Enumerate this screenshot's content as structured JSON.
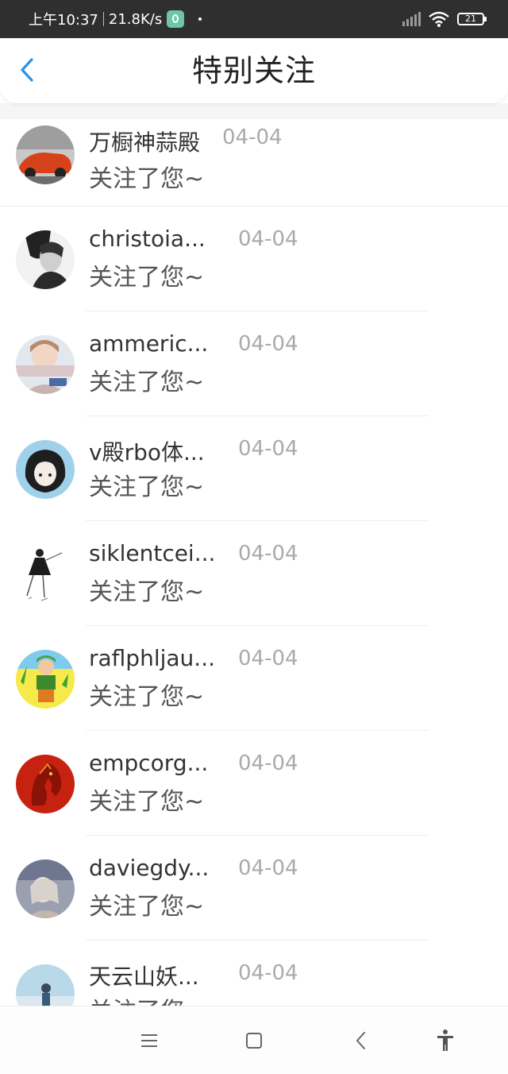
{
  "status_bar": {
    "time": "上午10:37",
    "speed": "21.8K/s",
    "battery": "21"
  },
  "header": {
    "title": "特别关注"
  },
  "items": [
    {
      "name": "万橱神蒜殿",
      "date": "04-04",
      "message": "关注了您~"
    },
    {
      "name": "christoia...",
      "date": "04-04",
      "message": "关注了您~"
    },
    {
      "name": "ammeric...",
      "date": "04-04",
      "message": "关注了您~"
    },
    {
      "name": "v殿rbo体...",
      "date": "04-04",
      "message": "关注了您~"
    },
    {
      "name": "siklentcei...",
      "date": "04-04",
      "message": "关注了您~"
    },
    {
      "name": "raflphljau...",
      "date": "04-04",
      "message": "关注了您~"
    },
    {
      "name": "empcorg...",
      "date": "04-04",
      "message": "关注了您~"
    },
    {
      "name": "daviegdy...",
      "date": "04-04",
      "message": "关注了您~"
    },
    {
      "name": "天云山妖...",
      "date": "04-04",
      "message": "关注了您~"
    }
  ],
  "nav": {
    "icons": [
      "menu-icon",
      "home-icon",
      "back-icon",
      "accessibility-icon"
    ]
  },
  "colors": {
    "accent": "#2a93e6",
    "title": "#222222",
    "date": "#aaaaaa"
  }
}
